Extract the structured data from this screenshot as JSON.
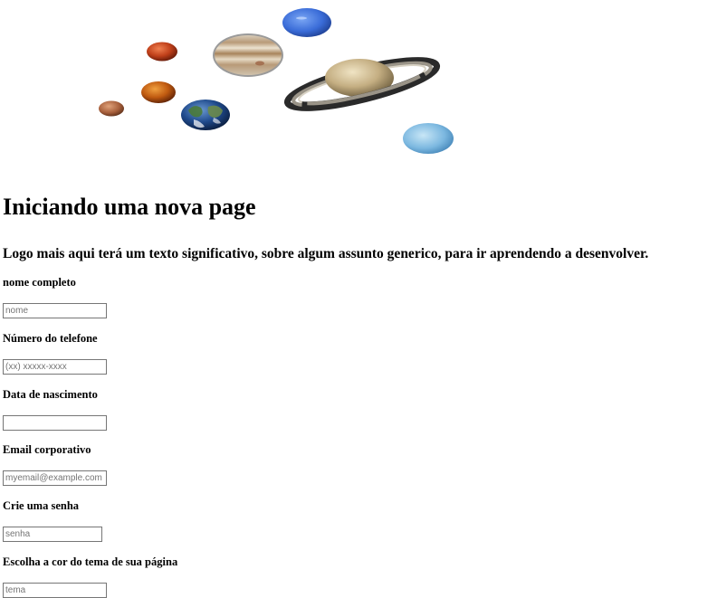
{
  "page": {
    "title": "Iniciando uma nova page",
    "subtitle": "Logo mais aqui terá um texto significativo, sobre algum assunto generico, para ir aprendendo a desenvolver."
  },
  "hero": {
    "planets": [
      "mercury",
      "venus",
      "earth",
      "mars",
      "jupiter",
      "saturn",
      "uranus",
      "neptune"
    ]
  },
  "form": {
    "name_label": "nome completo",
    "name_placeholder": "nome",
    "phone_label": "Número do telefone",
    "phone_placeholder": "(xx) xxxxx-xxxx",
    "birth_label": "Data de nascimento",
    "email_label": "Email corporativo",
    "email_placeholder": "myemail@example.com",
    "password_label": "Crie uma senha",
    "password_placeholder": "senha",
    "theme_label": "Escolha a cor do tema de sua página",
    "theme_placeholder": "tema"
  }
}
